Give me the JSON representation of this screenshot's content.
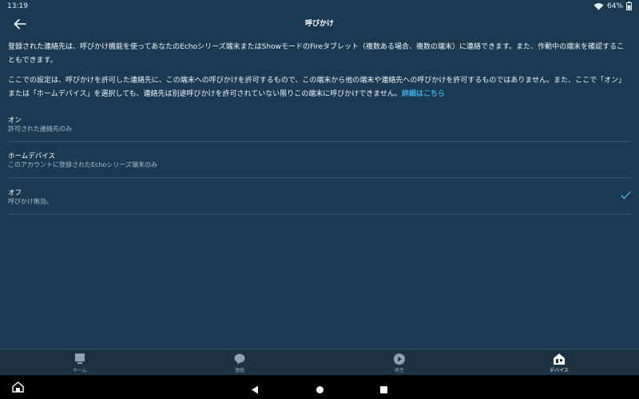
{
  "status_bar": {
    "time": "13:19",
    "battery": "64%"
  },
  "header": {
    "title": "呼びかけ"
  },
  "description": {
    "paragraph1": "登録された連絡先は、呼びかけ機能を使ってあなたのEchoシリーズ端末またはShowモードのFireタブレット（複数ある場合、複数の端末）に連絡できます。また、作動中の端末を確認することもできます。",
    "paragraph2": "ここでの設定は、呼びかけを許可した連絡先に、この端末への呼びかけを許可するもので、この端末から他の端末や連絡先への呼びかけを許可するものではありません。また、ここで「オン」または「ホームデバイス」を選択しても、連絡先は別途呼びかけを許可されていない限りこの端末に呼びかけできません。",
    "link": "詳細はこちら"
  },
  "options": [
    {
      "title": "オン",
      "subtitle": "許可された連絡先のみ",
      "selected": false
    },
    {
      "title": "ホームデバイス",
      "subtitle": "このアカウントに登録されたEchoシリーズ端末のみ",
      "selected": false
    },
    {
      "title": "オフ",
      "subtitle": "呼びかけ無効。",
      "selected": true
    }
  ],
  "bottom_nav": [
    {
      "label": "ホーム",
      "icon": "home-icon",
      "active": false
    },
    {
      "label": "連絡",
      "icon": "chat-bubble-icon",
      "active": false
    },
    {
      "label": "再生",
      "icon": "play-icon",
      "active": false
    },
    {
      "label": "デバイス",
      "icon": "devices-icon",
      "active": true
    }
  ],
  "system_nav": {
    "icons": [
      "home-launcher-icon",
      "back-triangle-icon",
      "home-circle-icon",
      "recents-square-icon"
    ]
  },
  "colors": {
    "background": "#1b3a52",
    "accent": "#3fb0e8",
    "system_bar": "#000000"
  }
}
